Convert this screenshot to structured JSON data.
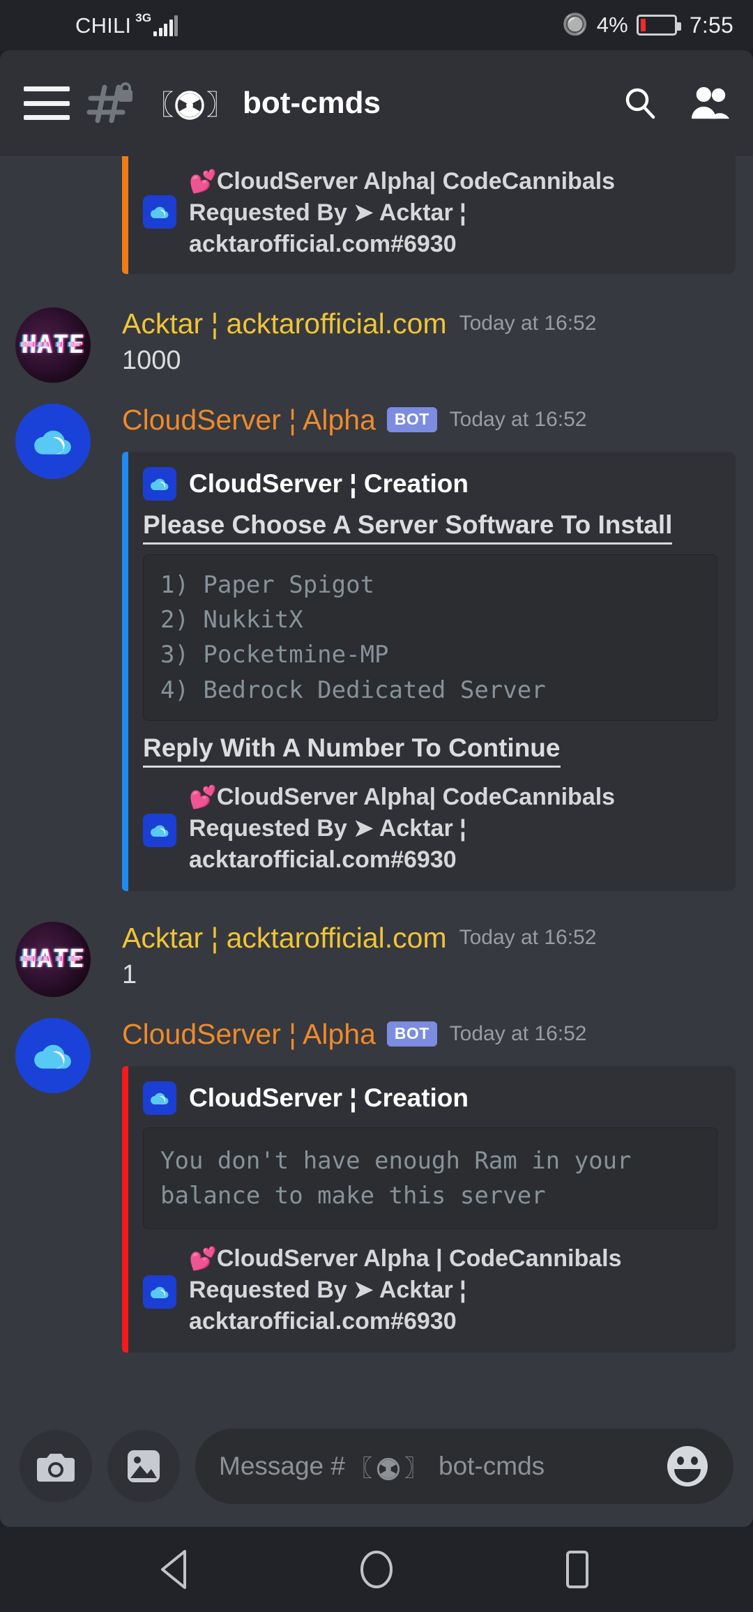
{
  "statusbar": {
    "carrier": "CHILI",
    "network": "3G",
    "bluetooth_icon": "bluetooth-icon",
    "battery_percent": "4%",
    "clock": "7:55"
  },
  "header": {
    "menu_icon": "hamburger-menu-icon",
    "channel_lock_icon": "locked-channel-icon",
    "bracket_open": "〖",
    "radiation_icon": "radiation-icon",
    "bracket_close": "〗",
    "channel_name": "bot-cmds",
    "search_icon": "search-icon",
    "members_icon": "members-icon"
  },
  "colors": {
    "embed_blue": "#1e8bf0",
    "embed_orange": "#f07b17",
    "embed_red": "#f61a1a",
    "username_gold": "#f0c537",
    "username_orange": "#ef8a2b",
    "bot_badge": "#7c8ce0",
    "chat_bg": "#36393f",
    "embed_bg": "#2f3136"
  },
  "messages": [
    {
      "type": "embed_only",
      "accent": "orange",
      "footer": {
        "line1": "CloudServer Alpha| CodeCannibals",
        "line2": "Requested By ➤ Acktar ¦",
        "line3": "acktarofficial.com#6930",
        "heart": "💕",
        "icon": "cloudserver-icon"
      }
    },
    {
      "type": "user",
      "avatar": "HATE",
      "username": "Acktar ¦ acktarofficial.com",
      "timestamp": "Today at 16:52",
      "content": "1000"
    },
    {
      "type": "bot",
      "avatar": "cloud-avatar",
      "username": "CloudServer ¦ Alpha",
      "badge": "BOT",
      "timestamp": "Today at 16:52",
      "embed": {
        "accent": "blue",
        "author": "CloudServer ¦ Creation",
        "author_icon": "cloudserver-icon",
        "description": "Please Choose A Server Software To Install",
        "codeblock": "1) Paper Spigot\n2) NukkitX\n3) Pocketmine-MP\n4) Bedrock Dedicated Server",
        "description2": "Reply With A Number To Continue",
        "footer": {
          "line1": "CloudServer Alpha| CodeCannibals",
          "line2": "Requested By ➤ Acktar ¦",
          "line3": "acktarofficial.com#6930",
          "heart": "💕",
          "icon": "cloudserver-icon"
        }
      }
    },
    {
      "type": "user",
      "avatar": "HATE",
      "username": "Acktar ¦ acktarofficial.com",
      "timestamp": "Today at 16:52",
      "content": "1"
    },
    {
      "type": "bot",
      "avatar": "cloud-avatar",
      "username": "CloudServer ¦ Alpha",
      "badge": "BOT",
      "timestamp": "Today at 16:52",
      "embed": {
        "accent": "red",
        "author": "CloudServer ¦ Creation",
        "author_icon": "cloudserver-icon",
        "codeblock": "You don't have enough Ram in your\nbalance to make this server",
        "footer": {
          "line1": "CloudServer Alpha | CodeCannibals",
          "line2": "Requested By ➤ Acktar ¦",
          "line3": "acktarofficial.com#6930",
          "heart": "💕",
          "icon": "cloudserver-icon"
        }
      }
    }
  ],
  "composer": {
    "camera_icon": "camera-icon",
    "gallery_icon": "gallery-icon",
    "placeholder_prefix": "Message #",
    "placeholder_bracket_open": "〖",
    "placeholder_radiation": "radiation-icon",
    "placeholder_bracket_close": "〗",
    "placeholder_channel": "bot-cmds",
    "emoji_icon": "emoji-icon"
  },
  "navbar": {
    "back_icon": "back-triangle-icon",
    "home_icon": "home-circle-icon",
    "recents_icon": "recents-square-icon"
  }
}
